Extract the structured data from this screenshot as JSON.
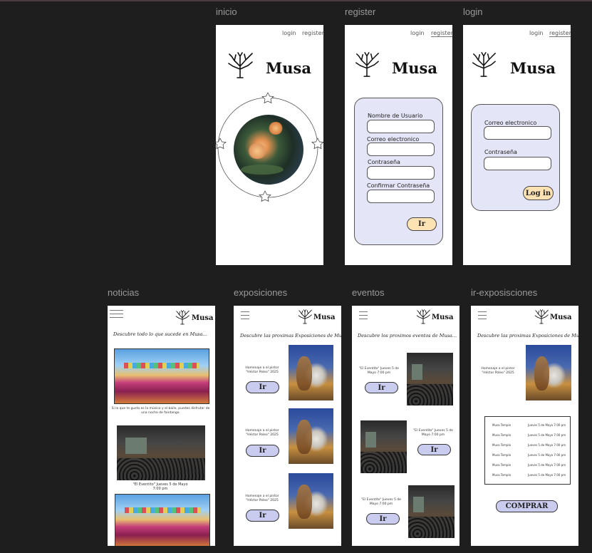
{
  "brand": "Musa",
  "nav": {
    "login": "login",
    "register": "register"
  },
  "frames": {
    "inicio": {
      "label": "inicio"
    },
    "register": {
      "label": "register",
      "fields": [
        "Nombre de Usuario",
        "Correo electronico",
        "Contraseña",
        "Confirmar Contraseña"
      ],
      "submit": "Ir"
    },
    "login": {
      "label": "login",
      "fields": [
        "Correo electronico",
        "Contraseña"
      ],
      "submit": "Log in"
    },
    "noticias": {
      "label": "noticias",
      "intro": "Descubre todo lo que sucede en Musa...",
      "caption1": "Si lo que te gusta es la música y el baile, puedes disfrutar de una noche de fandango.",
      "caption2": "\"El Eventito\" Jueves 5 de Mayo 7:00 pm"
    },
    "exposiciones": {
      "label": "exposiciones",
      "intro": "Descubre las proximas Exposiciones de Musa...",
      "items": [
        {
          "text": "Homenaje a el pintor \"Héctor Poleo\" 2025",
          "button": "Ir"
        },
        {
          "text": "Homenaje a el pintor \"Héctor Poleo\" 2025",
          "button": "Ir"
        },
        {
          "text": "Homenaje a el pintor \"Héctor Poleo\" 2025",
          "button": "Ir"
        }
      ]
    },
    "eventos": {
      "label": "eventos",
      "intro": "Descubre los proximos eventos de Musa...",
      "items": [
        {
          "text": "\"El Eventito\" Jueves 5 de Mayo 7:00 pm",
          "button": "Ir"
        },
        {
          "text": "\"El Eventito\" Jueves 5 de Mayo 7:00 pm",
          "button": "Ir"
        },
        {
          "text": "\"El Eventito\" Jueves 5 de Mayo 7:00 pm",
          "button": "Ir"
        }
      ]
    },
    "ir_exposisciones": {
      "label": "ir-exposisciones",
      "intro": "Descubre las proximas Exposiciones de Musa...",
      "text": "Homenaje a el pintor \"Héctor Poleo\" 2025",
      "schedule": [
        {
          "name": "Musa Templo",
          "date": "Jueves 5 de Mayo 7:00 pm"
        },
        {
          "name": "Musa Templo",
          "date": "Jueves 5 de Mayo 7:00 pm"
        },
        {
          "name": "Musa Templo",
          "date": "Jueves 5 de Mayo 7:00 pm"
        },
        {
          "name": "Musa Templo",
          "date": "Jueves 5 de Mayo 7:00 pm"
        },
        {
          "name": "Musa Templo",
          "date": "Jueves 5 de Mayo 7:00 pm"
        },
        {
          "name": "Musa Templo",
          "date": "Jueves 5 de Mayo 7:00 pm"
        }
      ],
      "buy": "COMPRAR"
    }
  }
}
